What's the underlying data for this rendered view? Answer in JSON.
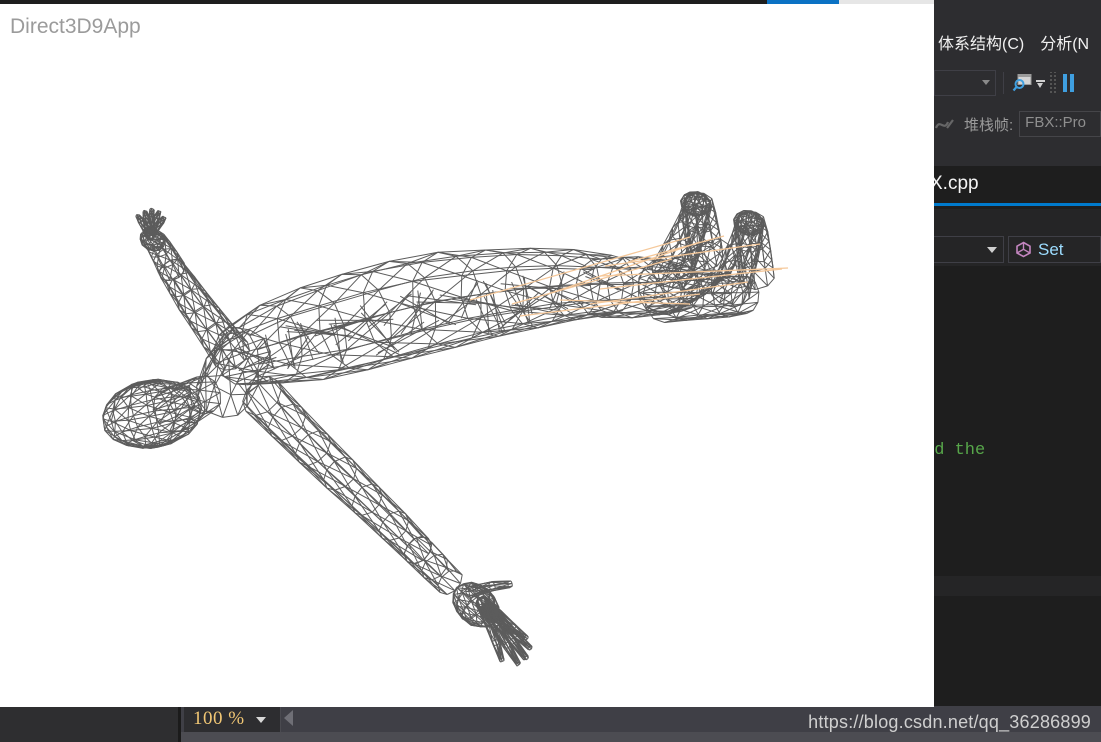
{
  "d3d_window": {
    "title": "Direct3D9App",
    "background_color": "#ffffff",
    "mesh_color": "#5c5c5c",
    "bone_color": "#f5c89a",
    "content_description": "wireframe triangulated humanoid character mesh lying diagonally, arms outstretched, with orange skeleton bone lines near the feet"
  },
  "ide": {
    "menu": [
      {
        "label": "体系结构(C)"
      },
      {
        "label": "分析(N"
      }
    ],
    "toolbar": {
      "combo_value": "",
      "icons": [
        "search-window-icon",
        "dropdown-caret-icon",
        "toolbar-grip-icon",
        "pause-icon"
      ]
    },
    "debug_toolbar": {
      "stack_frame_label": "堆栈帧:",
      "stack_frame_value": "FBX::Pro",
      "icon": "callstack-icon"
    },
    "tab": {
      "label": "X.cpp",
      "accent_color": "#007acc"
    },
    "navbar": {
      "scope_combo_value": "",
      "member_icon": "namespace-cube-icon",
      "member_text": "Set"
    },
    "editor": {
      "lines": [
        {
          "text": "ed the",
          "color": "#57a64a"
        }
      ]
    },
    "status": {
      "zoom_level": "100 %",
      "watermark": "https://blog.csdn.net/qq_36286899"
    }
  }
}
